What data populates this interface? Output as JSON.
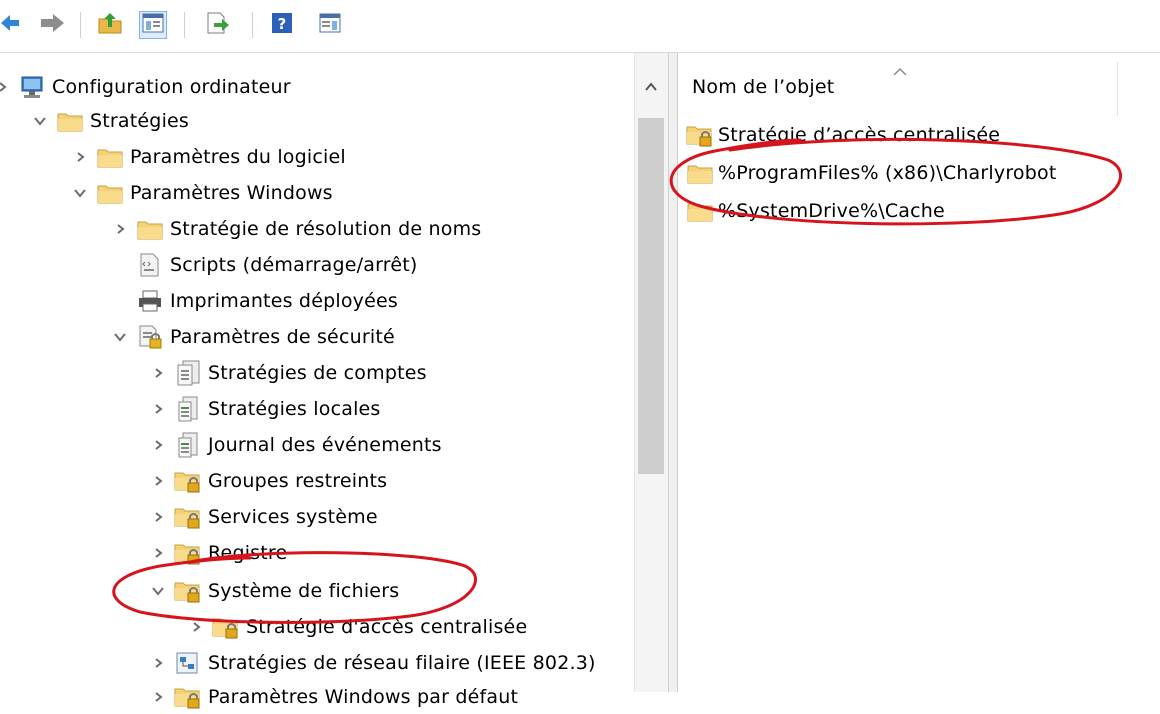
{
  "toolbar": {
    "buttons": [
      {
        "name": "back-button",
        "icon": "arrow-left-icon"
      },
      {
        "name": "forward-button",
        "icon": "arrow-right-icon"
      },
      {
        "name": "up-folder-button",
        "icon": "up-folder-icon"
      },
      {
        "name": "show-hide-tree-button",
        "icon": "console-tree-icon"
      },
      {
        "name": "export-list-button",
        "icon": "export-icon"
      },
      {
        "name": "help-button",
        "icon": "help-icon"
      },
      {
        "name": "show-action-pane-button",
        "icon": "action-pane-icon"
      }
    ]
  },
  "tree": {
    "items": [
      {
        "label": "Configuration ordinateur",
        "chevron": "right",
        "icon": "computer-icon"
      },
      {
        "label": "Stratégies",
        "chevron": "down",
        "icon": "folder-icon"
      },
      {
        "label": "Paramètres du logiciel",
        "chevron": "right",
        "icon": "folder-icon"
      },
      {
        "label": "Paramètres Windows",
        "chevron": "down",
        "icon": "folder-icon"
      },
      {
        "label": "Stratégie de résolution de noms",
        "chevron": "right",
        "icon": "folder-icon"
      },
      {
        "label": "Scripts (démarrage/arrêt)",
        "chevron": "none",
        "icon": "script-icon"
      },
      {
        "label": "Imprimantes déployées",
        "chevron": "none",
        "icon": "printer-icon"
      },
      {
        "label": "Paramètres de sécurité",
        "chevron": "down",
        "icon": "security-icon"
      },
      {
        "label": "Stratégies de comptes",
        "chevron": "right",
        "icon": "policy-icon"
      },
      {
        "label": "Stratégies locales",
        "chevron": "right",
        "icon": "policy-icon"
      },
      {
        "label": "Journal des événements",
        "chevron": "right",
        "icon": "policy-icon"
      },
      {
        "label": "Groupes restreints",
        "chevron": "right",
        "icon": "locked-folder-icon"
      },
      {
        "label": "Services système",
        "chevron": "right",
        "icon": "locked-folder-icon"
      },
      {
        "label": "Registre",
        "chevron": "right",
        "icon": "locked-folder-icon"
      },
      {
        "label": "Système de fichiers",
        "chevron": "down",
        "icon": "locked-folder-icon"
      },
      {
        "label": "Stratégie d'accès centralisée",
        "chevron": "right",
        "icon": "locked-folder-icon"
      },
      {
        "label": "Stratégies de réseau filaire (IEEE 802.3)",
        "chevron": "right",
        "icon": "network-policy-icon"
      },
      {
        "label": "Paramètres Windows par défaut",
        "chevron": "right",
        "icon": "locked-folder-icon"
      }
    ]
  },
  "list": {
    "column_header": "Nom de l’objet",
    "items": [
      {
        "label": "Stratégie d’accès centralisée",
        "icon": "locked-folder-icon"
      },
      {
        "label": "%ProgramFiles% (x86)\\Charlyrobot",
        "icon": "folder-icon"
      },
      {
        "label": "%SystemDrive%\\Cache",
        "icon": "folder-icon"
      }
    ]
  },
  "colors": {
    "annotation": "#d6141d",
    "folder": "#f2c94c",
    "chevron": "#6b6b6b"
  }
}
